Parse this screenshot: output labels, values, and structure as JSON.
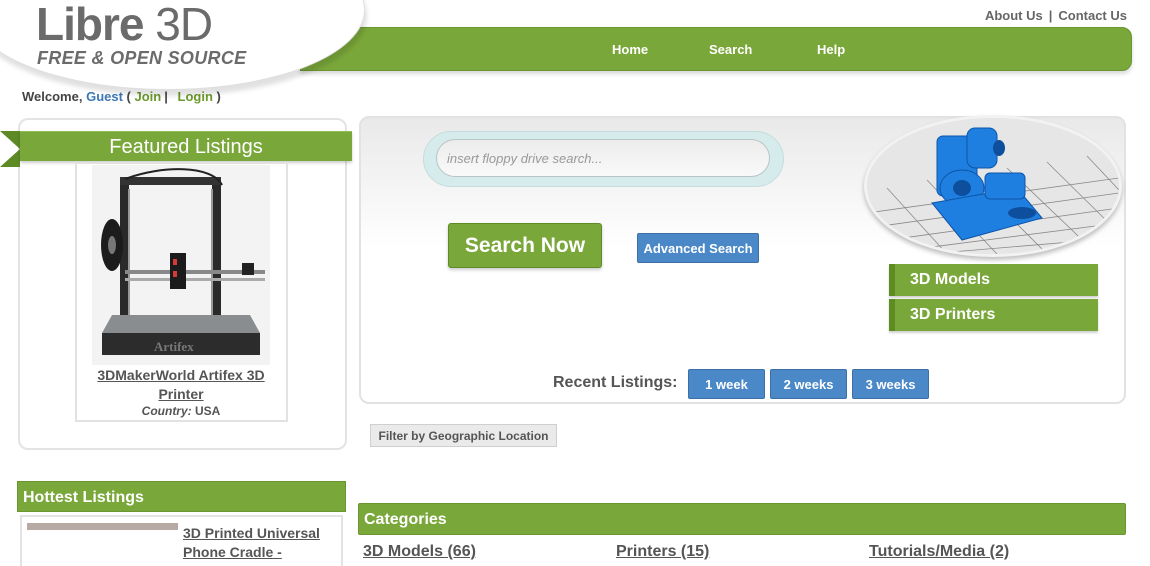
{
  "logo": {
    "main_bold": "Libre",
    "main_thin": "3D",
    "tagline": "FREE & OPEN SOURCE"
  },
  "toplinks": {
    "about": "About Us",
    "separator": "|",
    "contact": "Contact Us"
  },
  "nav": {
    "home": "Home",
    "search": "Search",
    "help": "Help"
  },
  "welcome": {
    "prefix": "Welcome,",
    "user": "Guest",
    "open": "(",
    "join": "Join",
    "sep": "|",
    "login": "Login",
    "close": ")"
  },
  "featured": {
    "heading": "Featured Listings",
    "item_title": "3DMakerWorld Artifex 3D Printer",
    "country_label": "Country:",
    "country_value": "USA",
    "image_brand_text": "Artifex"
  },
  "search": {
    "placeholder": "insert floppy drive search...",
    "search_now": "Search Now",
    "advanced": "Advanced Search"
  },
  "side_buttons": {
    "models": "3D Models",
    "printers": "3D Printers"
  },
  "recent": {
    "label": "Recent Listings:",
    "week1": "1 week",
    "week2": "2 weeks",
    "week3": "3 weeks"
  },
  "geo_filter": "Filter by Geographic Location",
  "hottest": {
    "heading": "Hottest Listings",
    "item_title": "3D Printed Universal Phone Cradle -"
  },
  "categories": {
    "heading": "Categories",
    "items": [
      "3D Models (66)",
      "Printers (15)",
      "Tutorials/Media (2)"
    ]
  },
  "colors": {
    "brand_green": "#7aa73a",
    "action_blue": "#4a88c8",
    "model_blue": "#1e7fe0",
    "logo_gray": "#6b6b6b"
  }
}
